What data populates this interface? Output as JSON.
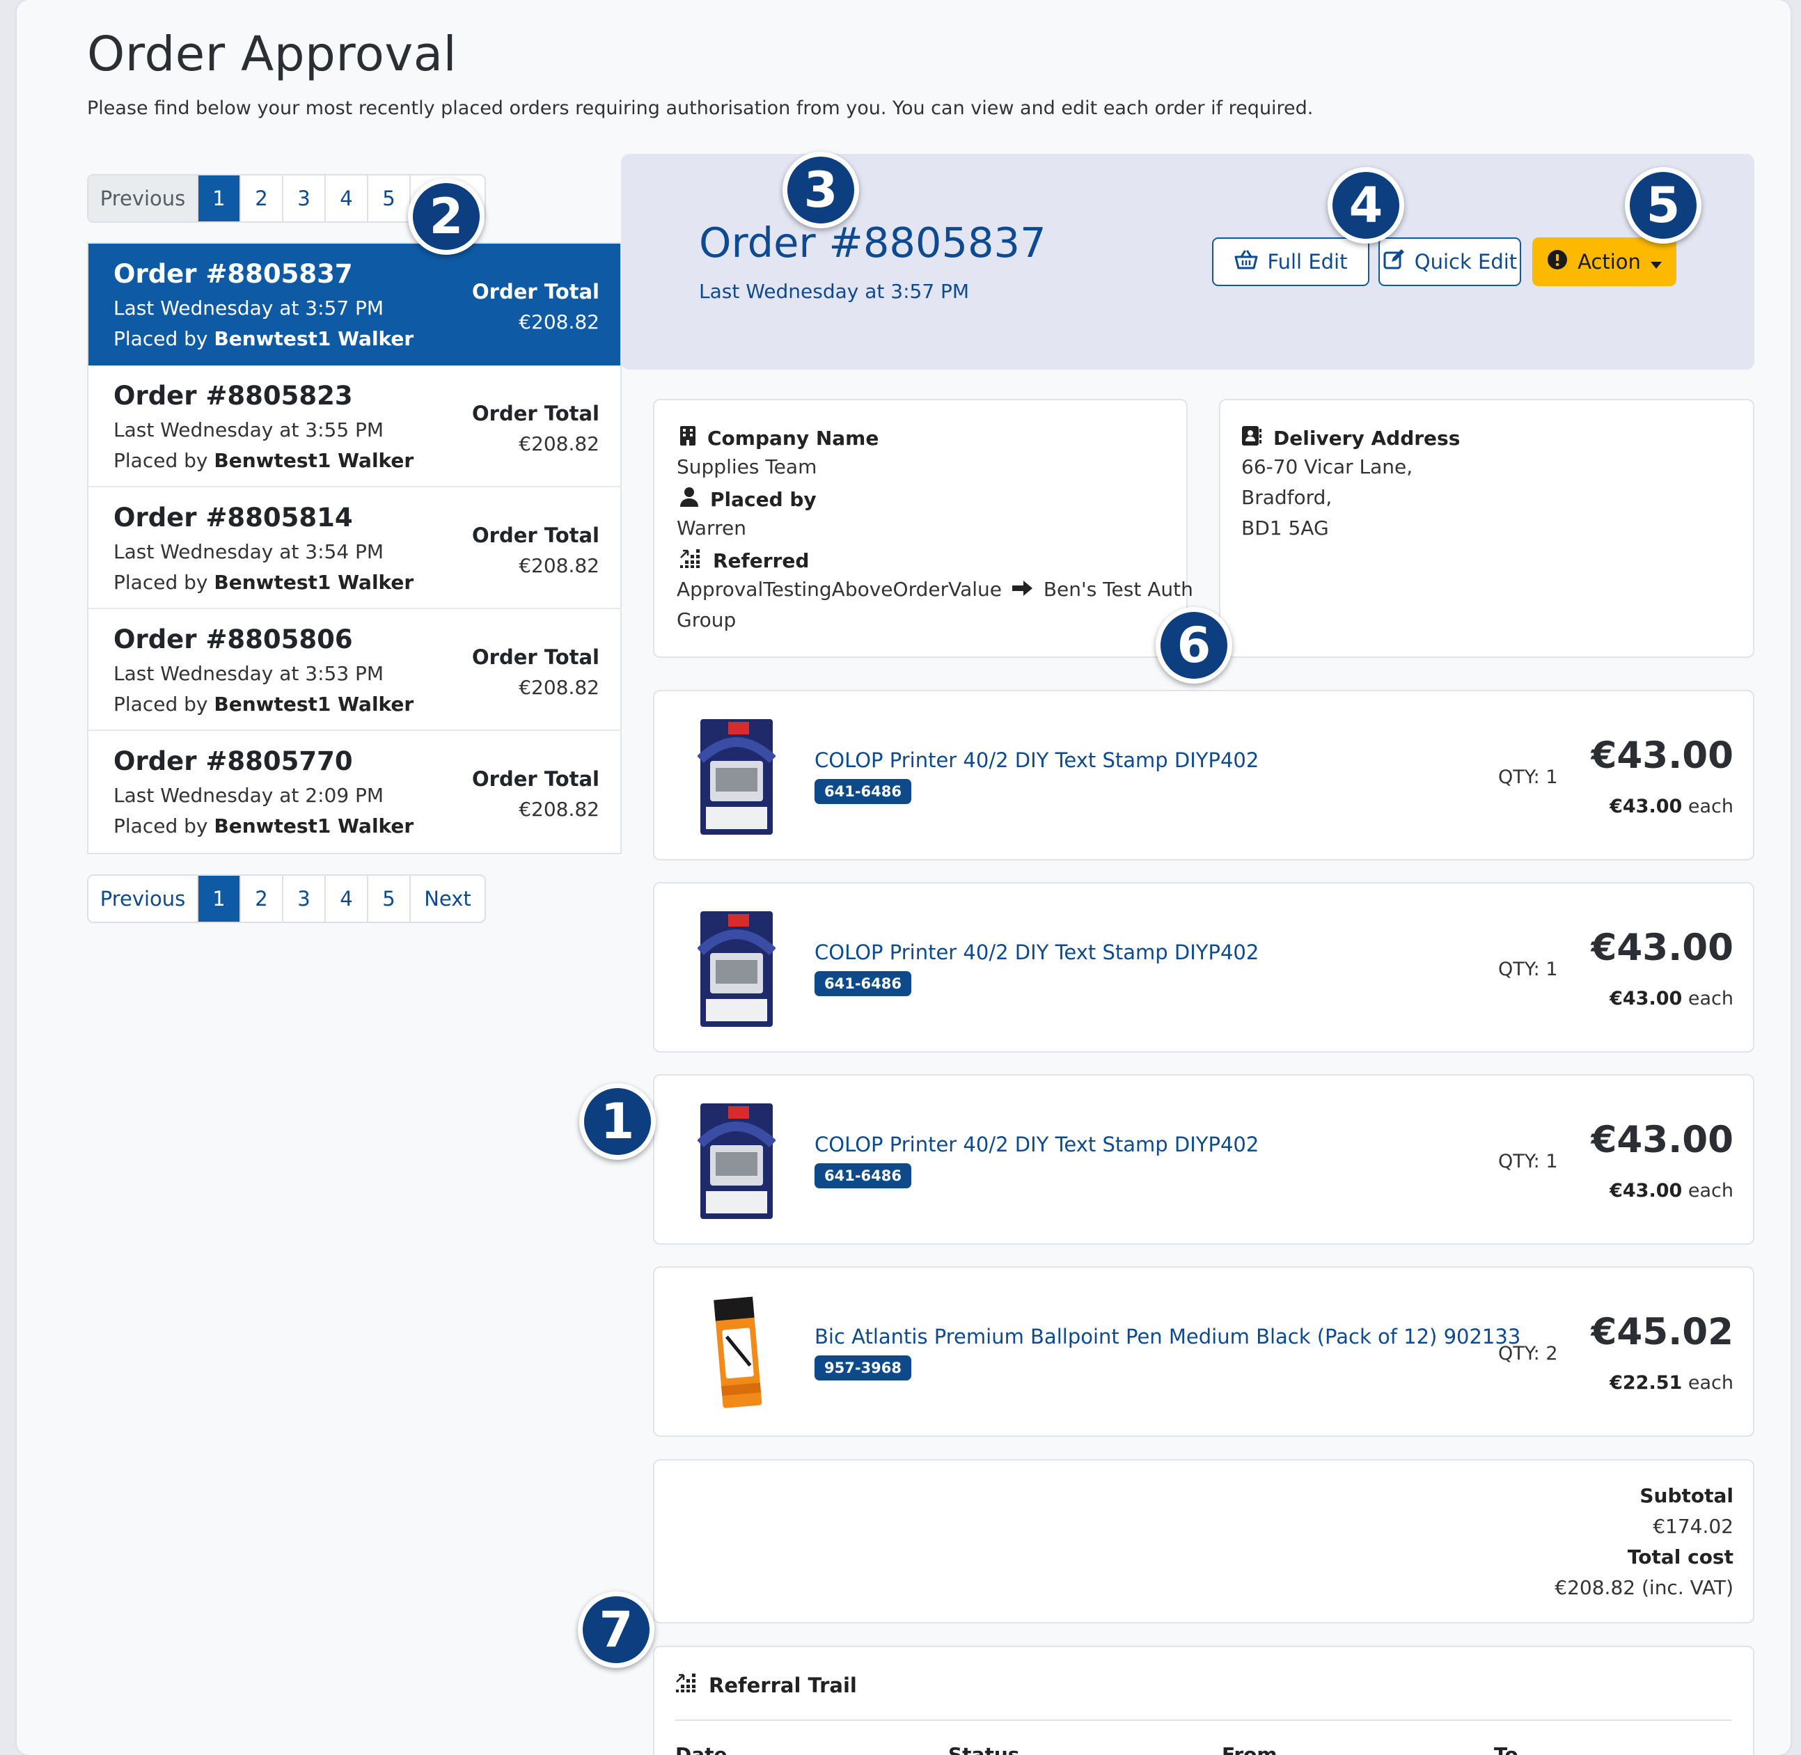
{
  "page": {
    "title": "Order Approval",
    "lead": "Please find below your most recently placed orders requiring authorisation from you. You can view and edit each order if required."
  },
  "pager_top": {
    "prev": "Previous",
    "pages": [
      "1",
      "2",
      "3",
      "4",
      "5"
    ],
    "next": "Next"
  },
  "pager_bottom": {
    "prev": "Previous",
    "pages": [
      "1",
      "2",
      "3",
      "4",
      "5"
    ],
    "next": "Next"
  },
  "orders": [
    {
      "number": "Order #8805837",
      "date": "Last Wednesday at 3:57 PM",
      "placed_prefix": "Placed by ",
      "placed_name": "Benwtest1 Walker",
      "total_label": "Order Total",
      "total": "€208.82"
    },
    {
      "number": "Order #8805823",
      "date": "Last Wednesday at 3:55 PM",
      "placed_prefix": "Placed by ",
      "placed_name": "Benwtest1 Walker",
      "total_label": "Order Total",
      "total": "€208.82"
    },
    {
      "number": "Order #8805814",
      "date": "Last Wednesday at 3:54 PM",
      "placed_prefix": "Placed by ",
      "placed_name": "Benwtest1 Walker",
      "total_label": "Order Total",
      "total": "€208.82"
    },
    {
      "number": "Order #8805806",
      "date": "Last Wednesday at 3:53 PM",
      "placed_prefix": "Placed by ",
      "placed_name": "Benwtest1 Walker",
      "total_label": "Order Total",
      "total": "€208.82"
    },
    {
      "number": "Order #8805770",
      "date": "Last Wednesday at 2:09 PM",
      "placed_prefix": "Placed by ",
      "placed_name": "Benwtest1 Walker",
      "total_label": "Order Total",
      "total": "€208.82"
    }
  ],
  "detail": {
    "title": "Order #8805837",
    "subtitle": "Last Wednesday at 3:57 PM",
    "full_edit": "Full Edit",
    "quick_edit": "Quick Edit",
    "action": "Action"
  },
  "info": {
    "company_label": "Company Name",
    "company": "Supplies Team",
    "placed_label": "Placed by",
    "placed": "Warren",
    "referred_label": "Referred",
    "referred_from": "ApprovalTestingAboveOrderValue",
    "referred_to": "Ben's Test Auth",
    "referred_to_cont": "Group",
    "delivery_label": "Delivery Address",
    "address": [
      "66-70 Vicar Lane,",
      "Bradford,",
      "BD1 5AG"
    ]
  },
  "items": [
    {
      "name": "COLOP Printer 40/2 DIY Text Stamp DIYP402",
      "sku": "641-6486",
      "qty": "QTY: 1",
      "price": "€43.00",
      "each_price": "€43.00",
      "each_suffix": " each",
      "image": "stamp"
    },
    {
      "name": "COLOP Printer 40/2 DIY Text Stamp DIYP402",
      "sku": "641-6486",
      "qty": "QTY: 1",
      "price": "€43.00",
      "each_price": "€43.00",
      "each_suffix": " each",
      "image": "stamp"
    },
    {
      "name": "COLOP Printer 40/2 DIY Text Stamp DIYP402",
      "sku": "641-6486",
      "qty": "QTY: 1",
      "price": "€43.00",
      "each_price": "€43.00",
      "each_suffix": " each",
      "image": "stamp"
    },
    {
      "name": "Bic Atlantis Premium Ballpoint Pen Medium Black (Pack of 12) 902133",
      "sku": "957-3968",
      "qty": "QTY: 2",
      "price": "€45.02",
      "each_price": "€22.51",
      "each_suffix": " each",
      "image": "pen-box"
    }
  ],
  "totals": {
    "subtotal_label": "Subtotal",
    "subtotal": "€174.02",
    "total_label": "Total cost",
    "total": "€208.82 (inc. VAT)"
  },
  "trail": {
    "title": "Referral Trail",
    "columns": [
      "Date",
      "Status",
      "From",
      "To"
    ]
  },
  "callouts": [
    "1",
    "2",
    "3",
    "4",
    "5",
    "6",
    "7"
  ],
  "colors": {
    "primary": "#0e5aa5",
    "link": "#0d4a8f",
    "warning": "#fcb900",
    "callout": "#0d3e7f",
    "header_bg": "#e3e5f2"
  }
}
